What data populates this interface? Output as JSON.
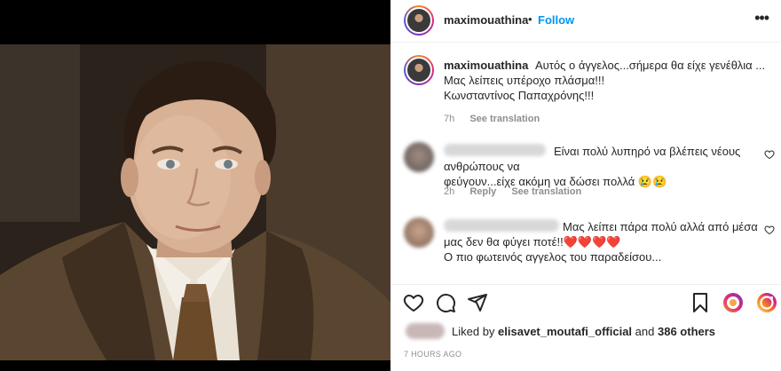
{
  "post": {
    "username": "maximouathina",
    "dot": "•",
    "follow_label": "Follow",
    "more_icon": "more-options-icon"
  },
  "caption": {
    "username": "maximouathina",
    "line1": "Αυτός ο άγγελος...σήμερα θα είχε γενέθλια ...",
    "line2": "Μας λείπεις υπέροχο πλάσμα!!!",
    "line3": "Κωνσταντίνος Παπαχρόνης!!!",
    "time": "7h",
    "see_translation": "See translation"
  },
  "comments": [
    {
      "text_line1": "Είναι πολύ λυπηρό να βλέπεις νέους ανθρώπους να",
      "text_line2": "φεύγουν...είχε ακόμη να δώσει πολλά 😢😢",
      "time": "2h",
      "reply": "Reply",
      "see_translation": "See translation"
    },
    {
      "text_line1": "Μας λείπει πάρα πολύ αλλά από μέσα",
      "text_line2": "μας δεν θα φύγει ποτέ!!❤️❤️❤️❤️",
      "text_line3": "Ο πιο φωτεινός αγγελος του παραδείσου..."
    }
  ],
  "likes": {
    "prefix": "Liked by",
    "user": "elisavet_moutafi_official",
    "and": "and",
    "others": "386 others"
  },
  "timestamp": "7 HOURS AGO",
  "colors": {
    "follow": "#0095f6",
    "text": "#262626",
    "muted": "#8e8e8e",
    "heart": "#ed4956"
  }
}
